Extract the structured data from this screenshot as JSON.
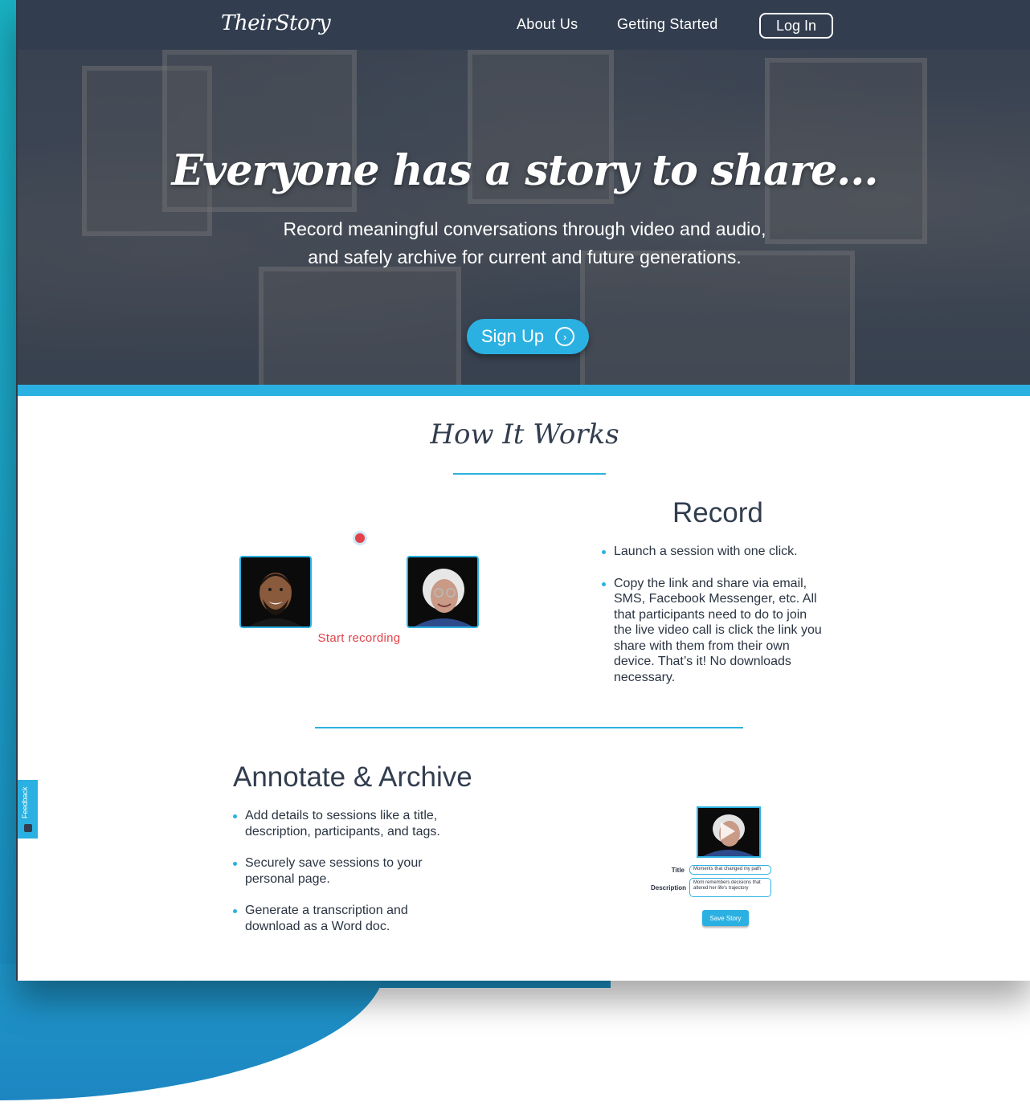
{
  "nav": {
    "logo": "TheirStory",
    "about": "About Us",
    "getting_started": "Getting Started",
    "login": "Log In"
  },
  "hero": {
    "title": "Everyone has a story to share...",
    "subtitle": "Record meaningful conversations through video and audio, and safely archive for current and future generations.",
    "signup": "Sign Up",
    "signup_icon": "›"
  },
  "how_it_works": {
    "title": "How It Works",
    "record": {
      "title": "Record",
      "start_recording": "Start recording",
      "bullets": [
        "Launch a session with one click.",
        "Copy the link and share via email, SMS, Facebook Messenger, etc. All that participants need to do to join the live video call is click the link you share with them from their own device. That’s it! No downloads necessary."
      ]
    },
    "annotate": {
      "title": "Annotate & Archive",
      "bullets": [
        "Add details to sessions like a title, description, participants, and tags.",
        "Securely save sessions to your personal page.",
        "Generate a transcription and download as a Word doc."
      ],
      "mock": {
        "title_label": "Title",
        "title_value": "Moments that changed my path",
        "description_label": "Description",
        "description_value": "Mom remembers decisions that altered her life's trajectory",
        "save_button": "Save Story"
      }
    }
  },
  "feedback": {
    "label": "Feedback"
  },
  "colors": {
    "accent": "#2bb1e1",
    "nav": "#323e4f",
    "record_red": "#e2434b"
  }
}
